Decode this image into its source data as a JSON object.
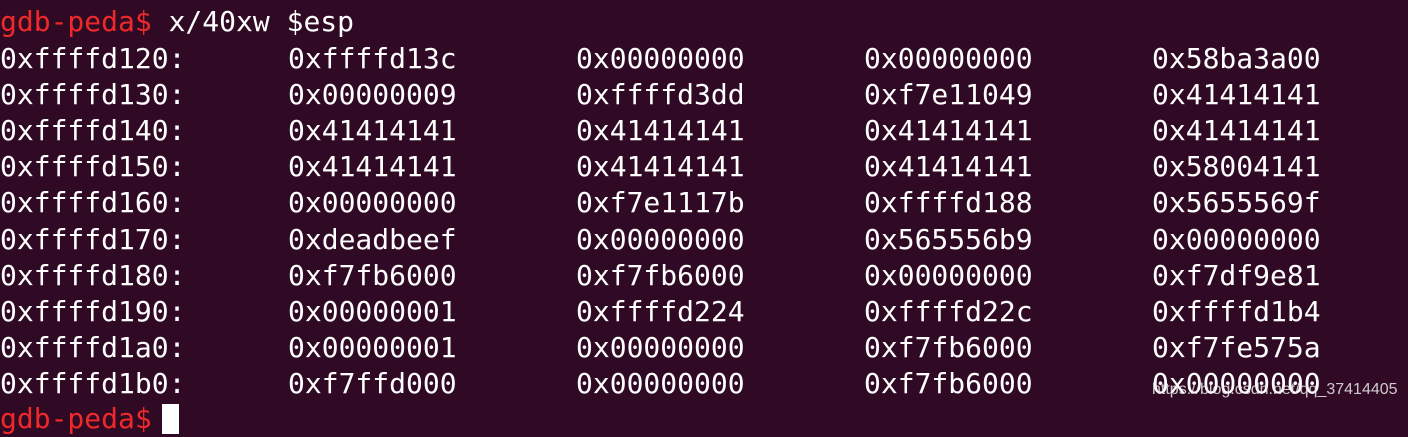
{
  "terminal": {
    "prompt": "gdb-peda$",
    "command": "x/40xw $esp",
    "rows": [
      {
        "address": "0xffffd120:",
        "words": [
          "0xffffd13c",
          "0x00000000",
          "0x00000000",
          "0x58ba3a00"
        ]
      },
      {
        "address": "0xffffd130:",
        "words": [
          "0x00000009",
          "0xffffd3dd",
          "0xf7e11049",
          "0x41414141"
        ]
      },
      {
        "address": "0xffffd140:",
        "words": [
          "0x41414141",
          "0x41414141",
          "0x41414141",
          "0x41414141"
        ]
      },
      {
        "address": "0xffffd150:",
        "words": [
          "0x41414141",
          "0x41414141",
          "0x41414141",
          "0x58004141"
        ]
      },
      {
        "address": "0xffffd160:",
        "words": [
          "0x00000000",
          "0xf7e1117b",
          "0xffffd188",
          "0x5655569f"
        ]
      },
      {
        "address": "0xffffd170:",
        "words": [
          "0xdeadbeef",
          "0x00000000",
          "0x565556b9",
          "0x00000000"
        ]
      },
      {
        "address": "0xffffd180:",
        "words": [
          "0xf7fb6000",
          "0xf7fb6000",
          "0x00000000",
          "0xf7df9e81"
        ]
      },
      {
        "address": "0xffffd190:",
        "words": [
          "0x00000001",
          "0xffffd224",
          "0xffffd22c",
          "0xffffd1b4"
        ]
      },
      {
        "address": "0xffffd1a0:",
        "words": [
          "0x00000001",
          "0x00000000",
          "0xf7fb6000",
          "0xf7fe575a"
        ]
      },
      {
        "address": "0xffffd1b0:",
        "words": [
          "0xf7ffd000",
          "0x00000000",
          "0xf7fb6000",
          "0x00000000"
        ]
      }
    ],
    "next_prompt": "gdb-peda$",
    "watermark": "https://blog.csdn.net/qq_37414405"
  },
  "colors": {
    "background": "#300a24",
    "prompt": "#ef2929",
    "text": "#ffffff"
  }
}
